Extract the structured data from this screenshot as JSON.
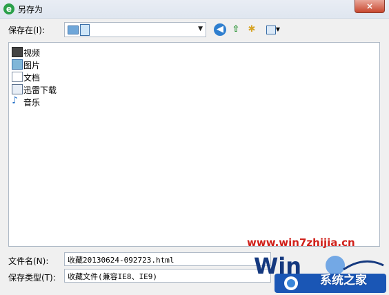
{
  "window": {
    "title": "另存为",
    "close_glyph": "×"
  },
  "toolbar": {
    "save_in_label": "保存在(I):",
    "location_value": "",
    "back_icon": "back-arrow-icon",
    "up_icon": "up-folder-icon",
    "new_folder_icon": "new-folder-icon",
    "view_menu_icon": "view-menu-icon"
  },
  "files": [
    {
      "name": "视频",
      "icon": "video-library-icon"
    },
    {
      "name": "图片",
      "icon": "picture-library-icon"
    },
    {
      "name": "文档",
      "icon": "document-library-icon"
    },
    {
      "name": "迅雷下载",
      "icon": "download-folder-icon"
    },
    {
      "name": "音乐",
      "icon": "music-library-icon"
    }
  ],
  "form": {
    "filename_label": "文件名(N):",
    "filename_value": "收藏20130624-092723.html",
    "filetype_label": "保存类型(T):",
    "filetype_value": "收藏文件(兼容IE8、IE9)"
  },
  "watermark": {
    "url": "www.win7zhijia.cn",
    "site_name": "系统之家"
  }
}
